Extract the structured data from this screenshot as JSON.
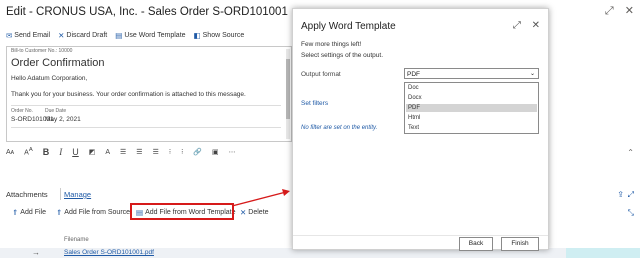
{
  "page": {
    "title": "Edit - CRONUS USA, Inc. - Sales Order S-ORD101001"
  },
  "toolbar": {
    "items": [
      {
        "label": "Send Email",
        "icon": "send-icon"
      },
      {
        "label": "Discard Draft",
        "icon": "close-icon"
      },
      {
        "label": "Use Word Template",
        "icon": "word-template-icon"
      },
      {
        "label": "Show Source",
        "icon": "show-source-icon"
      }
    ]
  },
  "email": {
    "from_line": "Bill-to Customer No.: 10000",
    "heading": "Order Confirmation",
    "greeting": "Hello Adatum Corporation,",
    "body": "Thank you for your business. Your order confirmation is attached to this message.",
    "order_no_label": "Order No.",
    "order_no": "S-ORD101001",
    "due_date_label": "Due Date",
    "due_date": "May 2, 2021"
  },
  "attachments": {
    "title": "Attachments",
    "manage": "Manage",
    "actions": [
      {
        "label": "Add File"
      },
      {
        "label": "Add File from Source"
      },
      {
        "label": "Add File from Word Template"
      },
      {
        "label": "Delete"
      }
    ],
    "column_filename": "Filename",
    "file": "Sales Order S-ORD101001.pdf"
  },
  "dialog": {
    "title": "Apply Word Template",
    "line1": "Few more things left!",
    "line2": "Select settings of the output.",
    "output_format_label": "Output format",
    "output_format_value": "PDF",
    "options": [
      "Doc",
      "Docx",
      "PDF",
      "Html",
      "Text"
    ],
    "selected_option": "PDF",
    "set_filters": "Set filters",
    "no_filters": "No filter are set on the entity.",
    "back": "Back",
    "finish": "Finish"
  },
  "colors": {
    "accent": "#1f5aa6",
    "highlight": "#d61a1a",
    "cyan": "#cfeef2"
  }
}
